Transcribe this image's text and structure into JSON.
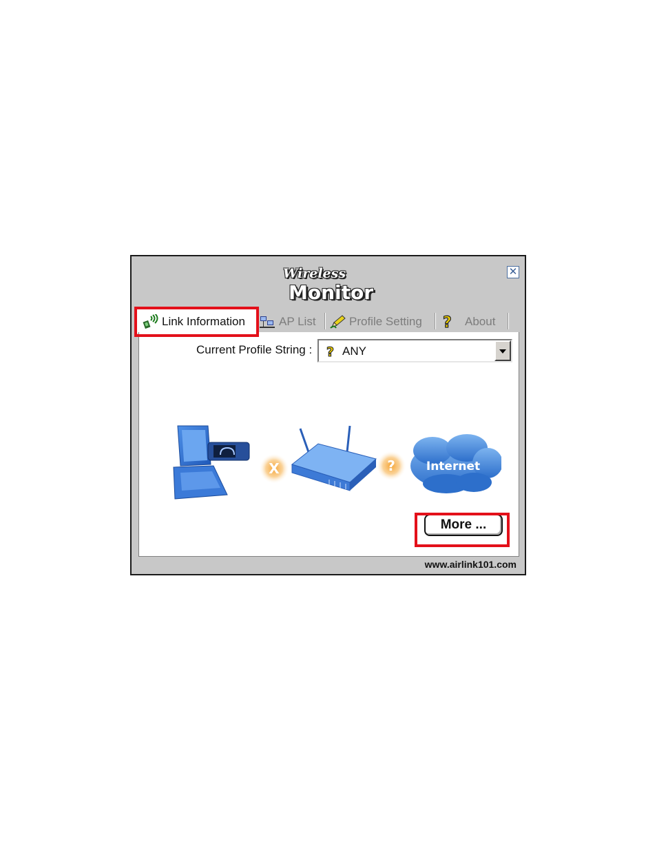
{
  "window": {
    "logo_small": "Wireless",
    "logo_large": "Monitor",
    "close_glyph": "✕",
    "footer_url": "www.airlink101.com"
  },
  "tabs": [
    {
      "label": "Link Information",
      "icon": "signal-antenna-icon",
      "active": true
    },
    {
      "label": "AP List",
      "icon": "network-computers-icon",
      "active": false
    },
    {
      "label": "Profile Setting",
      "icon": "pencil-icon",
      "active": false
    },
    {
      "label": "About",
      "icon": "question-mark-icon",
      "active": false
    }
  ],
  "profile": {
    "label": "Current Profile String :",
    "value": "ANY"
  },
  "diagram": {
    "laptop_to_ap_status": "X",
    "ap_to_internet_status": "?",
    "internet_label": "Internet"
  },
  "more_button_label": "More ...",
  "colors": {
    "highlight": "#e3101a",
    "window_bg": "#c8c8c8",
    "accent_blue": "#2f6fd0",
    "status_orange": "#f5a331"
  }
}
